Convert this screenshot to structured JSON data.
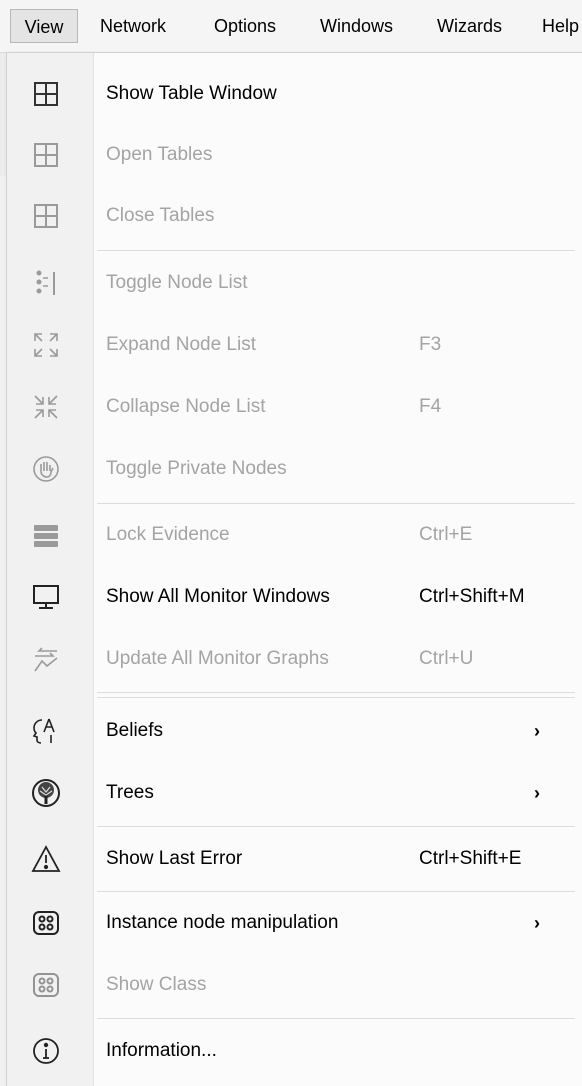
{
  "menubar": {
    "items": [
      {
        "label": "View"
      },
      {
        "label": "Network"
      },
      {
        "label": "Options"
      },
      {
        "label": "Windows"
      },
      {
        "label": "Wizards"
      },
      {
        "label": "Help"
      }
    ]
  },
  "menu": {
    "items": [
      {
        "label": "Show Table Window",
        "shortcut": "",
        "icon": "table-icon",
        "enabled": true
      },
      {
        "label": "Open Tables",
        "shortcut": "",
        "icon": "table-icon",
        "enabled": false
      },
      {
        "label": "Close Tables",
        "shortcut": "",
        "icon": "table-icon",
        "enabled": false
      },
      {
        "label": "Toggle Node List",
        "shortcut": "",
        "icon": "node-list-icon",
        "enabled": false
      },
      {
        "label": "Expand Node List",
        "shortcut": "F3",
        "icon": "expand-icon",
        "enabled": false
      },
      {
        "label": "Collapse Node List",
        "shortcut": "F4",
        "icon": "collapse-icon",
        "enabled": false
      },
      {
        "label": "Toggle Private Nodes",
        "shortcut": "",
        "icon": "hand-icon",
        "enabled": false
      },
      {
        "label": "Lock Evidence",
        "shortcut": "Ctrl+E",
        "icon": "lock-evidence-icon",
        "enabled": false
      },
      {
        "label": "Show All Monitor Windows",
        "shortcut": "Ctrl+Shift+M",
        "icon": "monitor-icon",
        "enabled": true
      },
      {
        "label": "Update All Monitor Graphs",
        "shortcut": "Ctrl+U",
        "icon": "update-graphs-icon",
        "enabled": false
      },
      {
        "label": "Beliefs",
        "shortcut": "",
        "icon": "beliefs-icon",
        "enabled": true,
        "submenu": "›"
      },
      {
        "label": "Trees",
        "shortcut": "",
        "icon": "tree-icon",
        "enabled": true,
        "submenu": "›"
      },
      {
        "label": "Show Last Error",
        "shortcut": "Ctrl+Shift+E",
        "icon": "warning-icon",
        "enabled": true
      },
      {
        "label": "Instance node manipulation",
        "shortcut": "",
        "icon": "instance-node-icon",
        "enabled": true,
        "submenu": "›"
      },
      {
        "label": "Show Class",
        "shortcut": "",
        "icon": "instance-node-icon",
        "enabled": false
      },
      {
        "label": "Information...",
        "shortcut": "",
        "icon": "info-icon",
        "enabled": true
      }
    ]
  }
}
